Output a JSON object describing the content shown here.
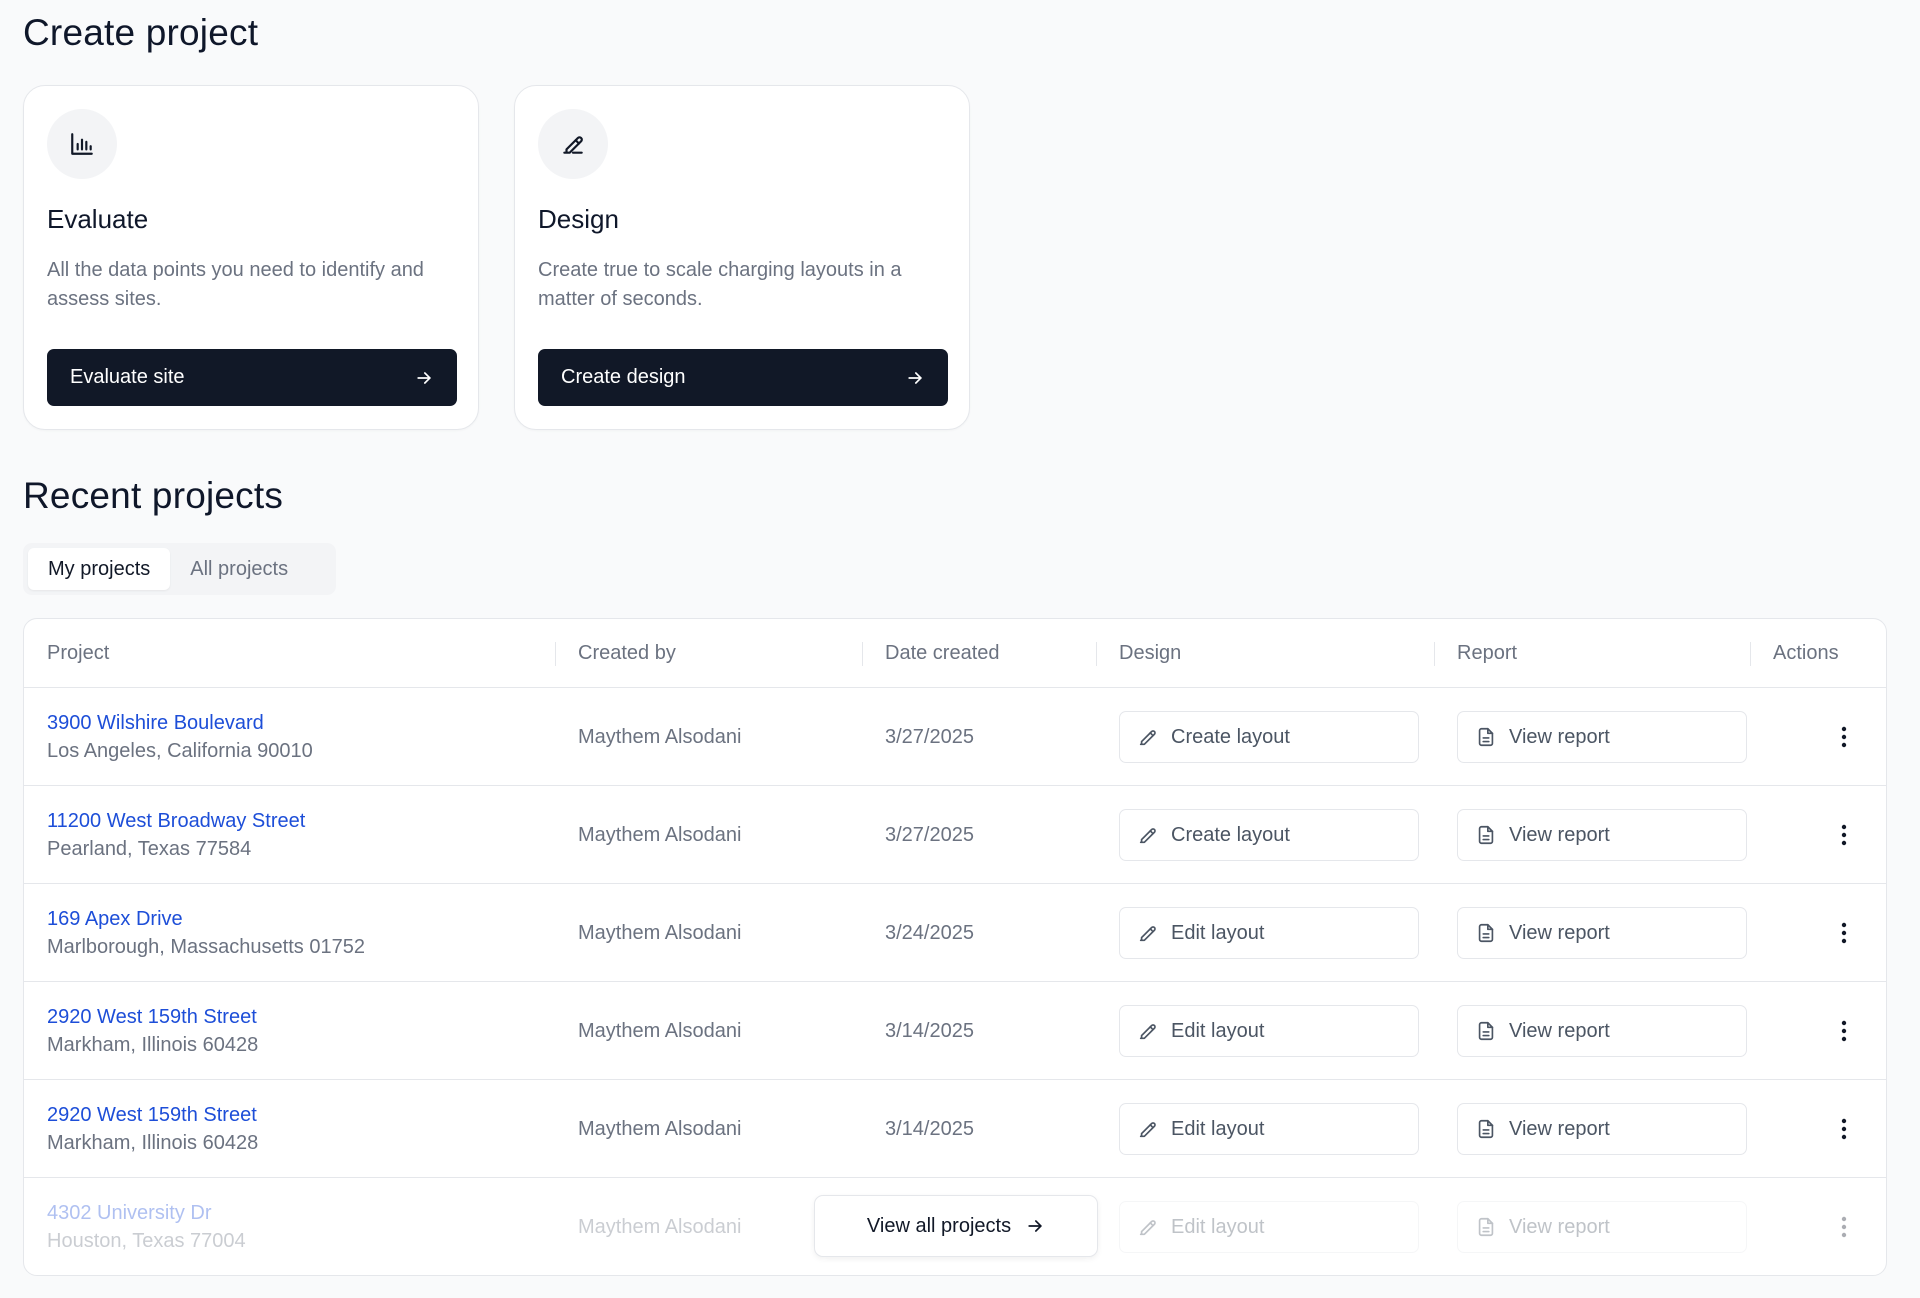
{
  "create": {
    "heading": "Create project",
    "cards": [
      {
        "icon": "bar-chart-icon",
        "title": "Evaluate",
        "description": "All the data points you need to identify and assess sites.",
        "button": "Evaluate site"
      },
      {
        "icon": "pen-icon",
        "title": "Design",
        "description": "Create true to scale charging layouts in a matter of seconds.",
        "button": "Create design"
      }
    ]
  },
  "recent": {
    "heading": "Recent projects",
    "tabs": [
      "My projects",
      "All projects"
    ],
    "active_tab": "My projects",
    "columns": [
      "Project",
      "Created by",
      "Date created",
      "Design",
      "Report",
      "Actions"
    ],
    "rows": [
      {
        "name": "3900 Wilshire Boulevard",
        "address": "Los Angeles, California 90010",
        "created_by": "Maythem Alsodani",
        "date": "3/27/2025",
        "design": "Create layout",
        "report": "View report"
      },
      {
        "name": "11200 West Broadway Street",
        "address": "Pearland, Texas 77584",
        "created_by": "Maythem Alsodani",
        "date": "3/27/2025",
        "design": "Create layout",
        "report": "View report"
      },
      {
        "name": "169 Apex Drive",
        "address": "Marlborough, Massachusetts 01752",
        "created_by": "Maythem Alsodani",
        "date": "3/24/2025",
        "design": "Edit layout",
        "report": "View report"
      },
      {
        "name": "2920 West 159th Street",
        "address": "Markham, Illinois 60428",
        "created_by": "Maythem Alsodani",
        "date": "3/14/2025",
        "design": "Edit layout",
        "report": "View report"
      },
      {
        "name": "2920 West 159th Street",
        "address": "Markham, Illinois 60428",
        "created_by": "Maythem Alsodani",
        "date": "3/14/2025",
        "design": "Edit layout",
        "report": "View report"
      },
      {
        "name": "4302 University Dr",
        "address": "Houston, Texas 77004",
        "created_by": "Maythem Alsodani",
        "date": "",
        "design": "Edit layout",
        "report": "View report"
      }
    ],
    "view_all": "View all projects"
  },
  "colors": {
    "primary_button": "#111827",
    "link": "#1d4ed8",
    "muted_text": "#6b7280",
    "border": "#e5e7eb",
    "page_bg": "#f9fafb"
  }
}
